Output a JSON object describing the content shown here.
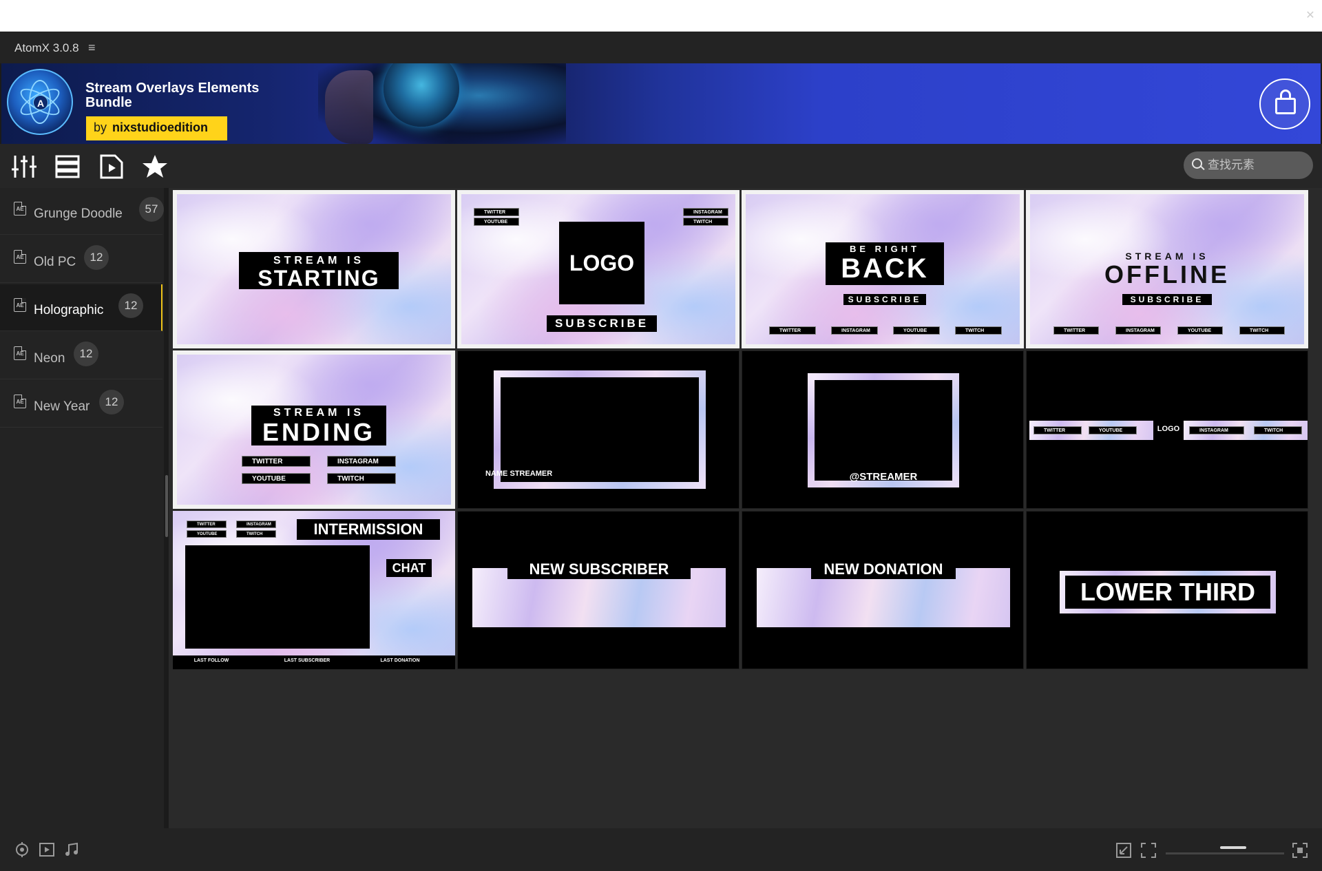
{
  "app": {
    "title": "AtomX 3.0.8",
    "menu_glyph": "≡"
  },
  "banner": {
    "title": "Stream Overlays Elements Bundle",
    "author_prefix": "by",
    "author": "nixstudioedition",
    "logo_letter": "A"
  },
  "toolbar": {
    "tools": [
      "sliders-icon",
      "list-icon",
      "video-file-icon",
      "star-icon"
    ],
    "search_placeholder": "查找元素"
  },
  "sidebar": {
    "items": [
      {
        "label": "Grunge Doodle",
        "count": "57",
        "active": false
      },
      {
        "label": "Old PC",
        "count": "12",
        "active": false
      },
      {
        "label": "Holographic",
        "count": "12",
        "active": true
      },
      {
        "label": "Neon",
        "count": "12",
        "active": false
      },
      {
        "label": "New Year",
        "count": "12",
        "active": false
      }
    ]
  },
  "tiles": {
    "starting": {
      "top": "STREAM IS",
      "main": "STARTING"
    },
    "logo": {
      "logo": "LOGO",
      "subscribe": "SUBSCRIBE",
      "twitter": "TWITTER",
      "youtube": "YOUTUBE",
      "instagram": "INSTAGRAM",
      "twitch": "TWITCH"
    },
    "brb": {
      "top": "BE RIGHT",
      "main": "BACK",
      "subscribe": "SUBSCRIBE",
      "twitter": "TWITTER",
      "instagram": "INSTAGRAM",
      "youtube": "YOUTUBE",
      "twitch": "TWITCH"
    },
    "offline": {
      "top": "STREAM IS",
      "main": "OFFLINE",
      "subscribe": "SUBSCRIBE",
      "twitter": "TWITTER",
      "instagram": "INSTAGRAM",
      "youtube": "YOUTUBE",
      "twitch": "TWITCH"
    },
    "ending": {
      "top": "STREAM IS",
      "main": "ENDING",
      "twitter": "TWITTER",
      "instagram": "INSTAGRAM",
      "youtube": "YOUTUBE",
      "twitch": "TWITCH"
    },
    "webcam1": {
      "label": "NAME STREAMER"
    },
    "webcam2": {
      "label": "@STREAMER"
    },
    "socialbar": {
      "twitter": "TWITTER",
      "youtube": "YOUTUBE",
      "logo": "LOGO",
      "instagram": "INSTAGRAM",
      "twitch": "TWITCH"
    },
    "intermission": {
      "title": "INTERMISSION",
      "chat": "CHAT",
      "twitter": "TWITTER",
      "instagram": "INSTAGRAM",
      "youtube": "YOUTUBE",
      "twitch": "TWITCH",
      "last_follow": "LAST FOLLOW",
      "last_subscriber": "LAST SUBSCRIBER",
      "last_donation": "LAST DONATION"
    },
    "new_subscriber": {
      "label": "NEW SUBSCRIBER"
    },
    "new_donation": {
      "label": "NEW DONATION"
    },
    "lower_third": {
      "label": "LOWER THIRD"
    }
  },
  "bottom": {
    "left_icons": [
      "preset-icon",
      "video-icon",
      "music-icon"
    ],
    "right_icons": [
      "import-icon",
      "fit-icon",
      "fullscreen-icon"
    ]
  },
  "colors": {
    "accent": "#f0c419",
    "banner_blue": "#3347d8",
    "author_yellow": "#ffd31a"
  }
}
